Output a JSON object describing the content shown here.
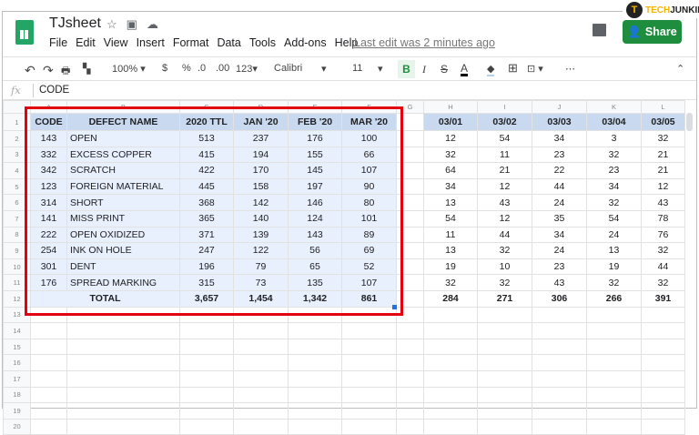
{
  "brand": {
    "logo_t": "T",
    "logo_text_a": "TECH",
    "logo_text_b": "JUNKIE"
  },
  "doc": {
    "title": "TJsheet",
    "last_edit": "Last edit was 2 minutes ago",
    "share": "Share"
  },
  "menu": [
    "File",
    "Edit",
    "View",
    "Insert",
    "Format",
    "Data",
    "Tools",
    "Add-ons",
    "Help"
  ],
  "toolbar": {
    "zoom": "100%",
    "currency": "$",
    "percent": "%",
    "dec_less": ".0",
    "dec_more": ".00",
    "format": "123",
    "font": "Calibri",
    "size": "11",
    "bold": "B",
    "italic": "I",
    "strike": "S",
    "text_color": "A",
    "more": "⋯"
  },
  "formula": {
    "fx": "fx",
    "value": "CODE"
  },
  "columns": [
    "",
    "A",
    "B",
    "C",
    "D",
    "E",
    "F",
    "G",
    "H",
    "I",
    "J",
    "K",
    "L"
  ],
  "headers": [
    "CODE",
    "DEFECT NAME",
    "2020 TTL",
    "JAN '20",
    "FEB '20",
    "MAR '20"
  ],
  "daily_headers": [
    "03/01",
    "03/02",
    "03/03",
    "03/04",
    "03/05"
  ],
  "rows": [
    {
      "code": "143",
      "name": "OPEN",
      "ttl": "513",
      "jan": "237",
      "feb": "176",
      "mar": "100",
      "daily": [
        "12",
        "54",
        "34",
        "3",
        "32"
      ]
    },
    {
      "code": "332",
      "name": "EXCESS COPPER",
      "ttl": "415",
      "jan": "194",
      "feb": "155",
      "mar": "66",
      "daily": [
        "32",
        "11",
        "23",
        "32",
        "21"
      ]
    },
    {
      "code": "342",
      "name": "SCRATCH",
      "ttl": "422",
      "jan": "170",
      "feb": "145",
      "mar": "107",
      "daily": [
        "64",
        "21",
        "22",
        "23",
        "21"
      ]
    },
    {
      "code": "123",
      "name": "FOREIGN MATERIAL",
      "ttl": "445",
      "jan": "158",
      "feb": "197",
      "mar": "90",
      "daily": [
        "34",
        "12",
        "44",
        "34",
        "12"
      ]
    },
    {
      "code": "314",
      "name": "SHORT",
      "ttl": "368",
      "jan": "142",
      "feb": "146",
      "mar": "80",
      "daily": [
        "13",
        "43",
        "24",
        "32",
        "43"
      ]
    },
    {
      "code": "141",
      "name": "MISS PRINT",
      "ttl": "365",
      "jan": "140",
      "feb": "124",
      "mar": "101",
      "daily": [
        "54",
        "12",
        "35",
        "54",
        "78"
      ]
    },
    {
      "code": "222",
      "name": "OPEN OXIDIZED",
      "ttl": "371",
      "jan": "139",
      "feb": "143",
      "mar": "89",
      "daily": [
        "11",
        "44",
        "34",
        "24",
        "76"
      ]
    },
    {
      "code": "254",
      "name": "INK ON HOLE",
      "ttl": "247",
      "jan": "122",
      "feb": "56",
      "mar": "69",
      "daily": [
        "13",
        "32",
        "24",
        "13",
        "32"
      ]
    },
    {
      "code": "301",
      "name": "DENT",
      "ttl": "196",
      "jan": "79",
      "feb": "65",
      "mar": "52",
      "daily": [
        "19",
        "10",
        "23",
        "19",
        "44"
      ]
    },
    {
      "code": "176",
      "name": "SPREAD MARKING",
      "ttl": "315",
      "jan": "73",
      "feb": "135",
      "mar": "107",
      "daily": [
        "32",
        "32",
        "43",
        "32",
        "32"
      ]
    }
  ],
  "total": {
    "label": "TOTAL",
    "ttl": "3,657",
    "jan": "1,454",
    "feb": "1,342",
    "mar": "861",
    "daily": [
      "284",
      "271",
      "306",
      "266",
      "391"
    ]
  },
  "accent": "#1e8e3e",
  "highlight": "#e3000f"
}
